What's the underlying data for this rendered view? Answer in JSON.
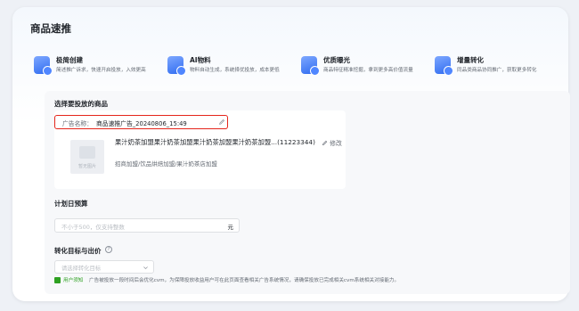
{
  "page": {
    "title": "商品速推"
  },
  "features": [
    {
      "title": "极简创建",
      "desc": "简述推广诉求，快速开启投放，入效更高"
    },
    {
      "title": "AI物料",
      "desc": "物料自动生成，系统择优投放，成本更低"
    },
    {
      "title": "优质曝光",
      "desc": "商品特征精准挖掘，拿到更多高价值流量"
    },
    {
      "title": "增量转化",
      "desc": "同品类商品协同推广，获取更多转化"
    }
  ],
  "product_section": {
    "label": "选择要投放的商品",
    "ad_name_label": "广告名称：",
    "ad_name_value": "商品速推广告_20240806_15:49",
    "product_title": "果汁奶茶加盟果汁奶茶加盟果汁奶茶加盟果汁奶茶加盟...(11223344)",
    "edit_label": "修改",
    "categories": "招商加盟/饮品烘焙加盟/果汁奶茶店加盟",
    "image_placeholder": "暂无图片"
  },
  "budget_section": {
    "label": "计划日预算",
    "placeholder": "不小于500，仅支持整数",
    "suffix": "元"
  },
  "goal_section": {
    "label": "转化目标与出价",
    "select_placeholder": "请选择转化目标",
    "notice_title": "用户须知",
    "notice_text": "广告被投放一段时间后会优化cvm，为保障投放收益用户可在此页面查看相关广告系统情况，请确保投放已完成相关cvm系统相关对接能力。"
  },
  "colors": {
    "accent": "#2f6bf0",
    "highlight_border": "#e5251b",
    "notice_green": "#2ea121"
  }
}
